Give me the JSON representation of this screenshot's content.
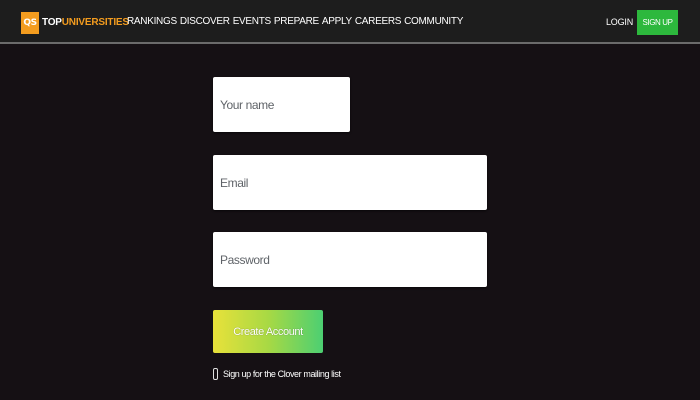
{
  "header": {
    "logo": {
      "badge": "QS",
      "text_top": "TOP",
      "text_rest": "UNIVERSITIES"
    },
    "nav": [
      {
        "label": "RANKINGS"
      },
      {
        "label": "DISCOVER"
      },
      {
        "label": "EVENTS"
      },
      {
        "label": "PREPARE"
      },
      {
        "label": "APPLY"
      },
      {
        "label": "CAREERS"
      },
      {
        "label": "COMMUNITY"
      }
    ],
    "login_label": "LOGIN",
    "signup_label": "SIGN UP"
  },
  "form": {
    "name_placeholder": "Your name",
    "email_placeholder": "Email",
    "password_placeholder": "Password",
    "submit_label": "Create Account",
    "mailing_label": "Sign up for the Clover mailing list",
    "mailing_checked": false
  },
  "colors": {
    "background": "#151014",
    "header": "#1d1d1d",
    "brand_orange": "#f39c1f",
    "signup_green": "#2db83d",
    "button_gradient_start": "#e8e13a",
    "button_gradient_end": "#4ccf72"
  }
}
